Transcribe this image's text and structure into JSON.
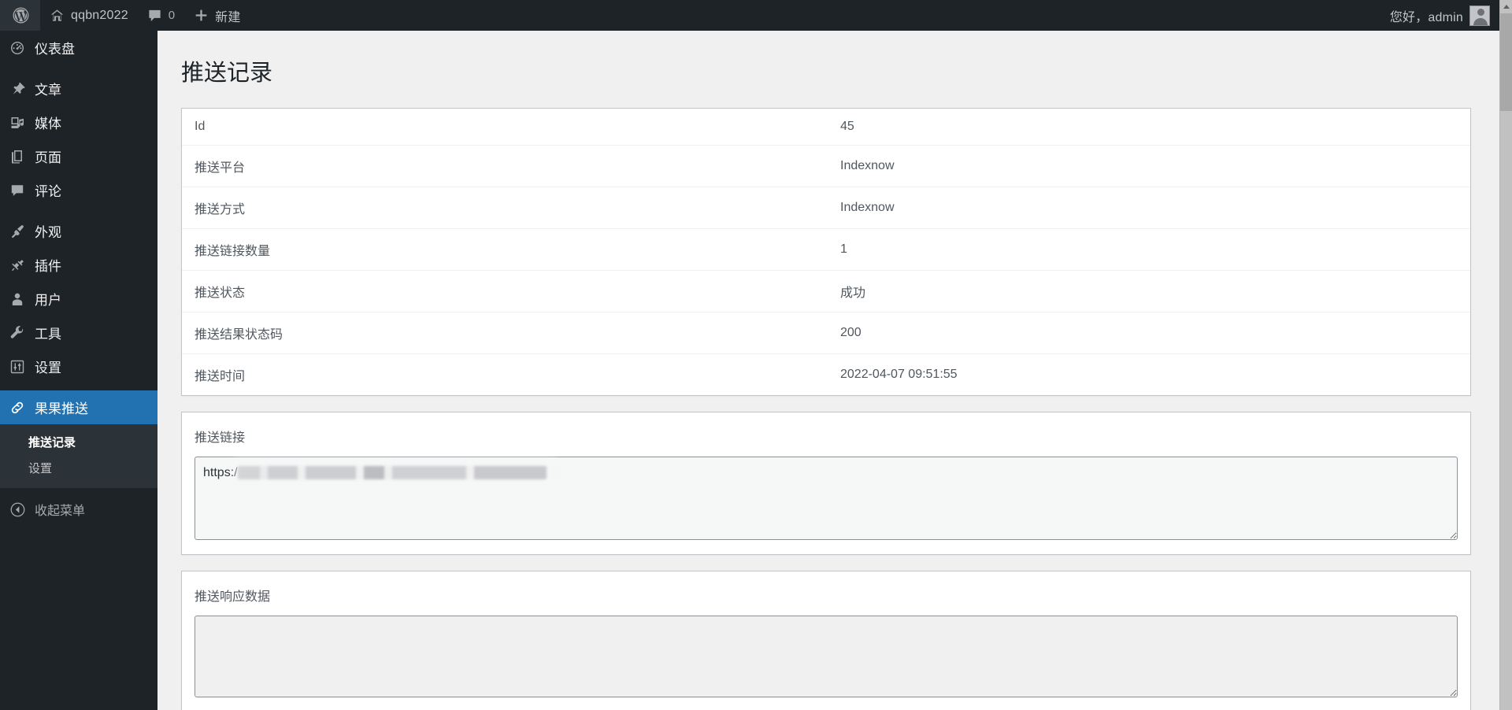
{
  "adminbar": {
    "logo_icon": "wordpress-logo-icon",
    "site_name": "qqbn2022",
    "site_icon": "home-icon",
    "comments_icon": "comment-bubble-icon",
    "comments_count": "0",
    "new_icon": "plus-icon",
    "new_label": "新建",
    "greeting": "您好，admin",
    "avatar_icon": "user-avatar-icon"
  },
  "sidebar": {
    "items": [
      {
        "label": "仪表盘",
        "icon": "dashboard-gauge-icon",
        "slug": "dashboard",
        "current": false
      },
      {
        "label": "文章",
        "icon": "pin-icon",
        "slug": "posts",
        "current": false
      },
      {
        "label": "媒体",
        "icon": "media-icon",
        "slug": "media",
        "current": false
      },
      {
        "label": "页面",
        "icon": "pages-icon",
        "slug": "pages",
        "current": false
      },
      {
        "label": "评论",
        "icon": "comment-bubble-icon",
        "slug": "comments",
        "current": false
      },
      {
        "label": "外观",
        "icon": "paintbrush-icon",
        "slug": "appearance",
        "current": false
      },
      {
        "label": "插件",
        "icon": "plug-icon",
        "slug": "plugins",
        "current": false
      },
      {
        "label": "用户",
        "icon": "user-icon",
        "slug": "users",
        "current": false
      },
      {
        "label": "工具",
        "icon": "wrench-icon",
        "slug": "tools",
        "current": false
      },
      {
        "label": "设置",
        "icon": "sliders-icon",
        "slug": "settings",
        "current": false
      },
      {
        "label": "果果推送",
        "icon": "link-chain-icon",
        "slug": "guoguo-push",
        "current": true
      }
    ],
    "submenu": [
      {
        "label": "推送记录",
        "current": true
      },
      {
        "label": "设置",
        "current": false
      }
    ],
    "collapse": {
      "label": "收起菜单",
      "icon": "collapse-arrow-left-icon"
    },
    "active_color": "#2271b1"
  },
  "main": {
    "page_title": "推送记录",
    "info_rows": [
      {
        "key": "Id",
        "value": "45"
      },
      {
        "key": "推送平台",
        "value": "Indexnow"
      },
      {
        "key": "推送方式",
        "value": "Indexnow"
      },
      {
        "key": "推送链接数量",
        "value": "1"
      },
      {
        "key": "推送状态",
        "value": "成功"
      },
      {
        "key": "推送结果状态码",
        "value": "200"
      },
      {
        "key": "推送时间",
        "value": "2022-04-07 09:51:55"
      }
    ],
    "links_panel": {
      "label": "推送链接",
      "value": "https:/",
      "placeholder": ""
    },
    "response_panel": {
      "label": "推送响应数据",
      "value": "",
      "placeholder": ""
    }
  },
  "scrollbar": {
    "up_icon": "scroll-up-arrow-icon",
    "down_icon": "scroll-down-arrow-icon",
    "thumb": "scrollbar-thumb"
  }
}
